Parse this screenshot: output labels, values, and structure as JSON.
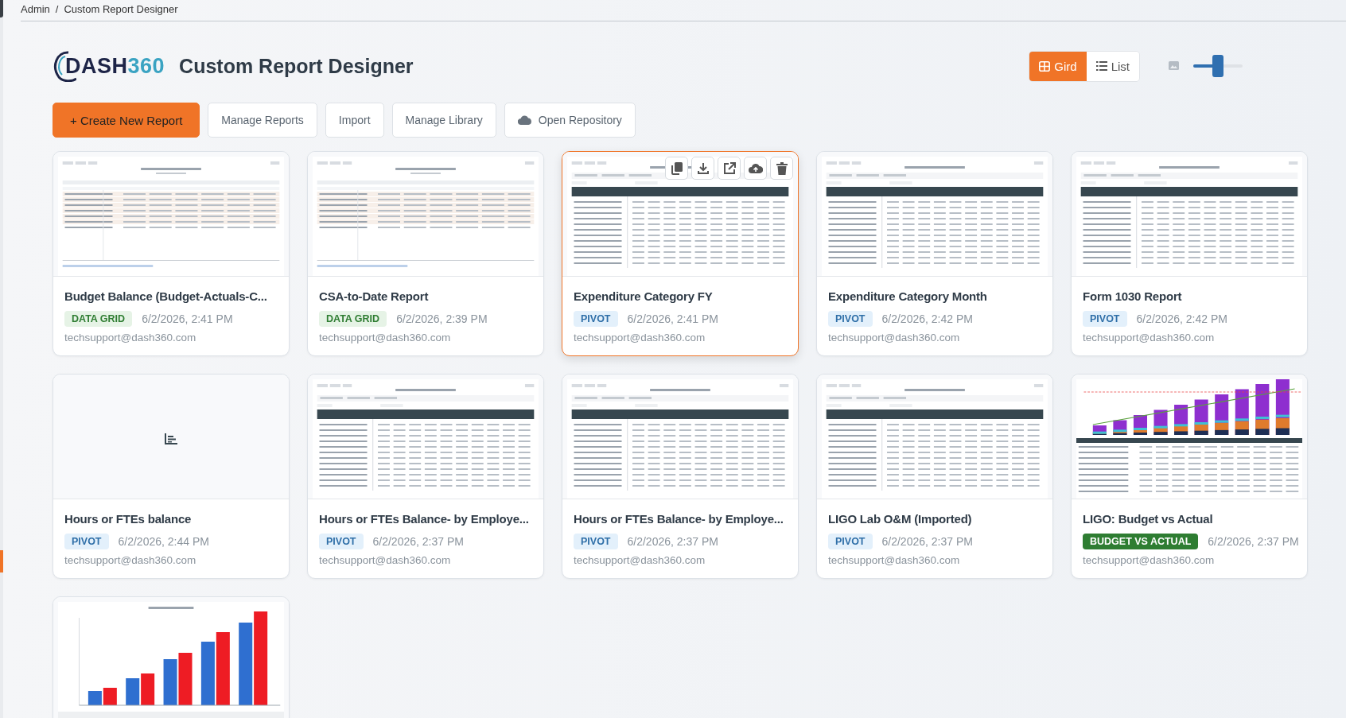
{
  "breadcrumb": [
    "Admin",
    "/",
    "Custom Report Designer"
  ],
  "logo": [
    "DASH",
    "360"
  ],
  "title": "Custom Report Designer",
  "view_toggle": [
    {
      "label": "Gird",
      "selected": true
    },
    {
      "label": "List",
      "selected": false
    }
  ],
  "thumbnail_size": {
    "level": 0.5
  },
  "actions": [
    {
      "label": "+ Create New Report",
      "kind": "primary"
    },
    {
      "label": "Manage Reports",
      "kind": "plain"
    },
    {
      "label": "Import",
      "kind": "plain"
    },
    {
      "label": "Manage Library",
      "kind": "plain"
    },
    {
      "label": "Open Repository",
      "kind": "cloud"
    }
  ],
  "reports": [
    {
      "title": "Budget Balance (Budget-Actuals-C...",
      "type": "DATA GRID",
      "kind": "data-grid",
      "date": "6/2/2026, 2:41 PM",
      "author": "techsupport@dash360.com",
      "preview": {
        "kind": "grid"
      },
      "selected": false
    },
    {
      "title": "CSA-to-Date Report",
      "type": "DATA GRID",
      "kind": "data-grid",
      "date": "6/2/2026, 2:39 PM",
      "author": "techsupport@dash360.com",
      "preview": {
        "kind": "grid"
      },
      "selected": false
    },
    {
      "title": "Expenditure Category FY",
      "type": "PIVOT",
      "kind": "pivot",
      "date": "6/2/2026, 2:41 PM",
      "author": "techsupport@dash360.com",
      "preview": {
        "kind": "pivot"
      },
      "selected": true
    },
    {
      "title": "Expenditure Category Month",
      "type": "PIVOT",
      "kind": "pivot",
      "date": "6/2/2026, 2:42 PM",
      "author": "techsupport@dash360.com",
      "preview": {
        "kind": "pivot"
      },
      "selected": false
    },
    {
      "title": "Form 1030 Report",
      "type": "PIVOT",
      "kind": "pivot",
      "date": "6/2/2026, 2:42 PM",
      "author": "techsupport@dash360.com",
      "preview": {
        "kind": "pivot"
      },
      "selected": false
    },
    {
      "title": "Hours or FTEs balance",
      "type": "PIVOT",
      "kind": "pivot",
      "date": "6/2/2026, 2:44 PM",
      "author": "techsupport@dash360.com",
      "preview": {
        "kind": "empty"
      },
      "selected": false
    },
    {
      "title": "Hours or FTEs Balance- by Employe...",
      "type": "PIVOT",
      "kind": "pivot",
      "date": "6/2/2026, 2:37 PM",
      "author": "techsupport@dash360.com",
      "preview": {
        "kind": "pivot"
      },
      "selected": false
    },
    {
      "title": "Hours or FTEs Balance- by Employe...",
      "type": "PIVOT",
      "kind": "pivot",
      "date": "6/2/2026, 2:37 PM",
      "author": "techsupport@dash360.com",
      "preview": {
        "kind": "pivot"
      },
      "selected": false
    },
    {
      "title": "LIGO Lab O&M (Imported)",
      "type": "PIVOT",
      "kind": "pivot",
      "date": "6/2/2026, 2:37 PM",
      "author": "techsupport@dash360.com",
      "preview": {
        "kind": "pivot"
      },
      "selected": false
    },
    {
      "title": "LIGO: Budget vs Actual",
      "type": "BUDGET VS ACTUAL",
      "kind": "budget-vs-actual",
      "date": "6/2/2026, 2:37 PM",
      "author": "techsupport@dash360.com",
      "preview": {
        "kind": "stacked"
      },
      "selected": false
    },
    {
      "preview": {
        "kind": "bars"
      },
      "selected": false
    }
  ]
}
